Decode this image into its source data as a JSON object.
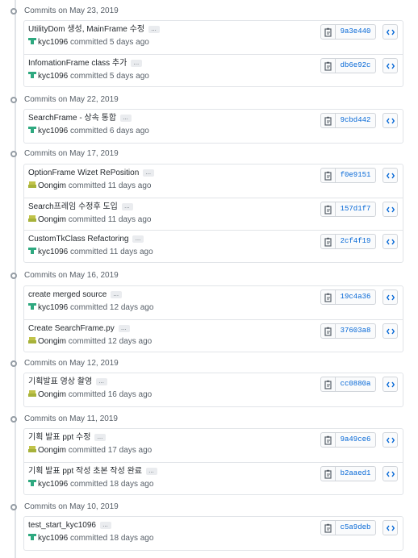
{
  "groups": [
    {
      "title": "Commits on May 23, 2019",
      "commits": [
        {
          "message": "UtilityDom 생성, MainFrame 수정",
          "author": "kyc1096",
          "avatar": "kyc",
          "meta": "committed 5 days ago",
          "sha": "9a3e440"
        },
        {
          "message": "InfomationFrame class 추가",
          "author": "kyc1096",
          "avatar": "kyc",
          "meta": "committed 5 days ago",
          "sha": "db6e92c"
        }
      ]
    },
    {
      "title": "Commits on May 22, 2019",
      "commits": [
        {
          "message": "SearchFrame - 상속 통합",
          "author": "kyc1096",
          "avatar": "kyc",
          "meta": "committed 6 days ago",
          "sha": "9cbd442"
        }
      ]
    },
    {
      "title": "Commits on May 17, 2019",
      "commits": [
        {
          "message": "OptionFrame Wizet RePosition",
          "author": "Oongim",
          "avatar": "oon",
          "meta": "committed 11 days ago",
          "sha": "f0e9151"
        },
        {
          "message": "Search프레임 수정후 도입",
          "author": "Oongim",
          "avatar": "oon",
          "meta": "committed 11 days ago",
          "sha": "157d1f7"
        },
        {
          "message": "CustomTkClass Refactoring",
          "author": "kyc1096",
          "avatar": "kyc",
          "meta": "committed 11 days ago",
          "sha": "2cf4f19"
        }
      ]
    },
    {
      "title": "Commits on May 16, 2019",
      "commits": [
        {
          "message": "create merged source",
          "author": "kyc1096",
          "avatar": "kyc",
          "meta": "committed 12 days ago",
          "sha": "19c4a36"
        },
        {
          "message": "Create SearchFrame.py",
          "author": "Oongim",
          "avatar": "oon",
          "meta": "committed 12 days ago",
          "sha": "37603a8"
        }
      ]
    },
    {
      "title": "Commits on May 12, 2019",
      "commits": [
        {
          "message": "기획발표 영상 촬영",
          "author": "Oongim",
          "avatar": "oon",
          "meta": "committed 16 days ago",
          "sha": "cc0880a"
        }
      ]
    },
    {
      "title": "Commits on May 11, 2019",
      "commits": [
        {
          "message": "기획 발표 ppt 수정",
          "author": "Oongim",
          "avatar": "oon",
          "meta": "committed 17 days ago",
          "sha": "9a49ce6"
        },
        {
          "message": "기획 발표 ppt 작성 초본 작성 완료",
          "author": "kyc1096",
          "avatar": "kyc",
          "meta": "committed 18 days ago",
          "sha": "b2aaed1"
        }
      ]
    },
    {
      "title": "Commits on May 10, 2019",
      "commits": [
        {
          "message": "test_start_kyc1096",
          "author": "kyc1096",
          "avatar": "kyc",
          "meta": "committed 18 days ago",
          "sha": "c5a9deb"
        }
      ]
    }
  ],
  "ellipsis_label": "…",
  "icons": {
    "copy": "clippy-icon",
    "browse": "code-icon",
    "expand": "ellipsis-icon"
  },
  "colors": {
    "sha": "#0366d6",
    "border": "#e1e4e8",
    "muted": "#586069"
  }
}
